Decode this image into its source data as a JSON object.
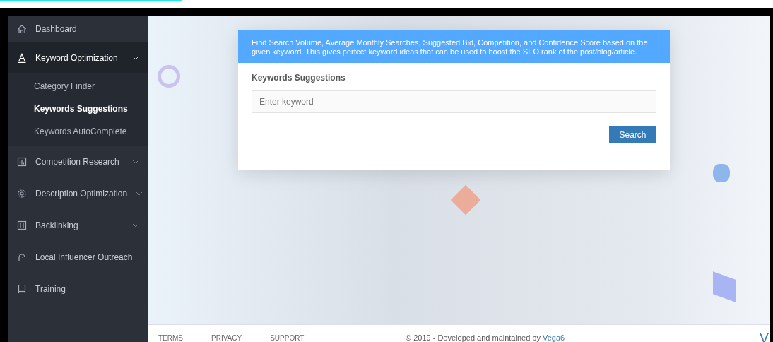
{
  "sidebar": {
    "items": [
      {
        "label": "Dashboard",
        "kind": "link"
      },
      {
        "label": "Keyword Optimization",
        "kind": "group",
        "expanded": true,
        "children": [
          {
            "label": "Category Finder",
            "selected": false
          },
          {
            "label": "Keywords Suggestions",
            "selected": true
          },
          {
            "label": "Keywords AutoComplete",
            "selected": false
          }
        ]
      },
      {
        "label": "Competition Research",
        "kind": "group",
        "expanded": false
      },
      {
        "label": "Description Optimization",
        "kind": "group",
        "expanded": false
      },
      {
        "label": "Backlinking",
        "kind": "group",
        "expanded": false
      },
      {
        "label": "Local Influencer Outreach",
        "kind": "link"
      },
      {
        "label": "Training",
        "kind": "link"
      }
    ]
  },
  "card": {
    "info": "Find Search Volume, Average Monthly Searches, Suggested Bid, Competition, and Confidence Score based on the given keyword. This gives perfect keyword ideas that can be used to boost the SEO rank of the post/blog/article.",
    "label": "Keywords Suggestions",
    "placeholder": "Enter keyword",
    "button": "Search"
  },
  "footer": {
    "links": [
      "TERMS",
      "PRIVACY",
      "SUPPORT"
    ],
    "copyright": "© 2019 - Developed and maintained by",
    "company": "Vega6",
    "logo": "V"
  }
}
